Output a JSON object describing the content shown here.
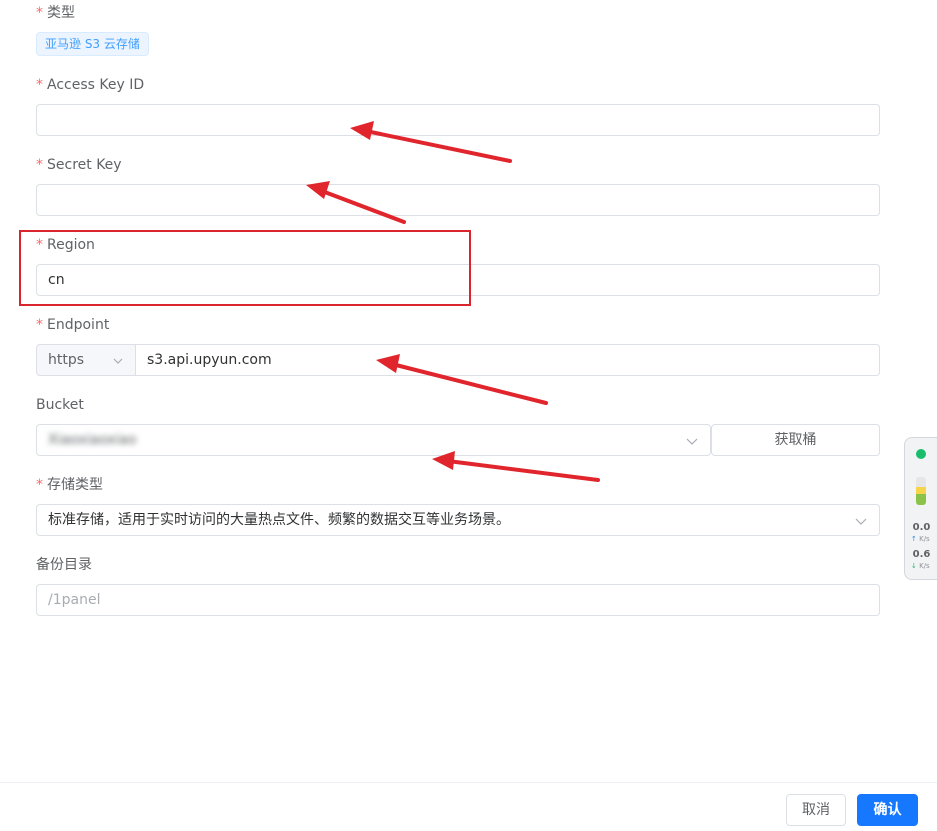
{
  "form": {
    "type_label": "类型",
    "type_value": "亚马逊 S3 云存储",
    "access_key_label": "Access Key ID",
    "access_key_value": "",
    "secret_key_label": "Secret Key",
    "secret_key_value": "",
    "region_label": "Region",
    "region_value": "cn",
    "endpoint_label": "Endpoint",
    "endpoint_protocol": "https",
    "endpoint_value": "s3.api.upyun.com",
    "bucket_label": "Bucket",
    "bucket_value": "Xiaoxiaoxiao",
    "fetch_bucket_button": "获取桶",
    "storage_class_label": "存储类型",
    "storage_class_value": "标准存储，适用于实时访问的大量热点文件、频繁的数据交互等业务场景。",
    "backup_dir_label": "备份目录",
    "backup_dir_placeholder": "/1panel",
    "required_mark": "*"
  },
  "footer": {
    "cancel_label": "取消",
    "confirm_label": "确认"
  },
  "speed_widget": {
    "upload_value": "0.0",
    "upload_unit": "K/s",
    "download_value": "0.6",
    "download_unit": "K/s"
  },
  "colors": {
    "accent": "#1677ff",
    "required": "#f56c6c",
    "annotation": "#d9262e",
    "tag_text": "#409eff",
    "tag_bg": "#ecf5ff"
  }
}
